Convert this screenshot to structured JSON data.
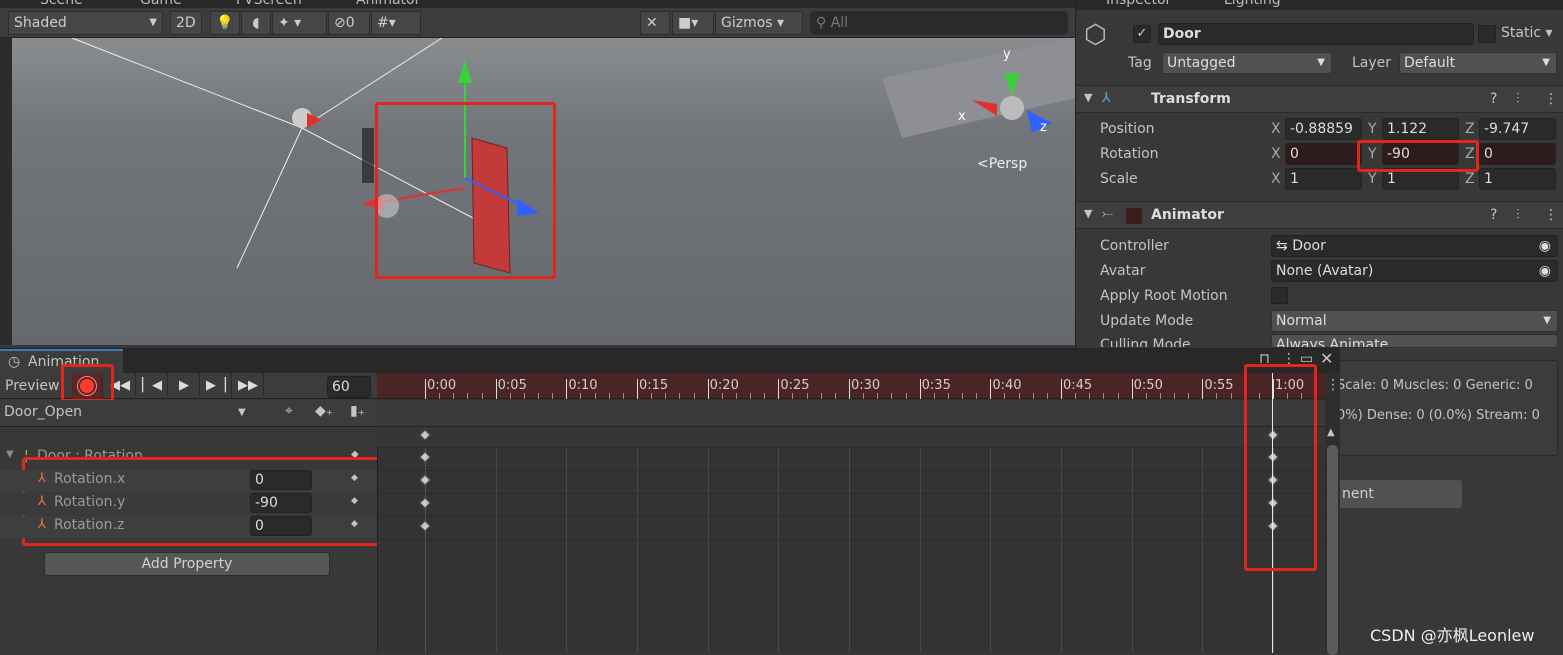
{
  "scene": {
    "tabs": [
      "Scene",
      "Game",
      "FVScreen",
      "Animator"
    ],
    "shading": "Shaded",
    "mode2d": "2D",
    "hidden_count": "0",
    "gizmos": "Gizmos",
    "search_placeholder": "All",
    "persp": "Persp",
    "axes": {
      "x": "x",
      "y": "y",
      "z": "z"
    }
  },
  "inspector": {
    "tabs": [
      "Inspector",
      "Lighting"
    ],
    "name": "Door",
    "active": true,
    "static_label": "Static",
    "tag_label": "Tag",
    "tag": "Untagged",
    "layer_label": "Layer",
    "layer": "Default",
    "transform": {
      "title": "Transform",
      "rows": [
        {
          "label": "Position",
          "x": "-0.88859",
          "y": "1.122",
          "z": "-9.747"
        },
        {
          "label": "Rotation",
          "x": "0",
          "y": "-90",
          "z": "0"
        },
        {
          "label": "Scale",
          "x": "1",
          "y": "1",
          "z": "1"
        }
      ]
    },
    "animator": {
      "title": "Animator",
      "controller_label": "Controller",
      "controller": "Door",
      "avatar_label": "Avatar",
      "avatar": "None (Avatar)",
      "root_motion_label": "Apply Root Motion",
      "update_label": "Update Mode",
      "update": "Normal",
      "culling_label": "Culling Mode",
      "culling": "Always Animate",
      "info1": "Scale: 0 Muscles: 0 Generic: 0",
      "info2": "0%) Dense: 0 (0.0%) Stream: 0",
      "add_component": "nent"
    }
  },
  "animation": {
    "tab": "Animation",
    "preview": "Preview",
    "frame": "60",
    "clip": "Door_Open",
    "group": "Door : Rotation",
    "properties": [
      {
        "name": "Rotation.x",
        "value": "0"
      },
      {
        "name": "Rotation.y",
        "value": "-90"
      },
      {
        "name": "Rotation.z",
        "value": "0"
      }
    ],
    "add_property": "Add Property",
    "ticks": [
      "0:00",
      "0:05",
      "0:10",
      "0:15",
      "0:20",
      "0:25",
      "0:30",
      "0:35",
      "0:40",
      "0:45",
      "0:50",
      "0:55",
      "1:00"
    ],
    "keyframe_times": [
      0,
      60
    ]
  },
  "watermark": "CSDN @亦枫Leonlew",
  "colors": {
    "record": "#ff3b30",
    "highlight": "#e0261e",
    "ruler": "#4b2525"
  }
}
